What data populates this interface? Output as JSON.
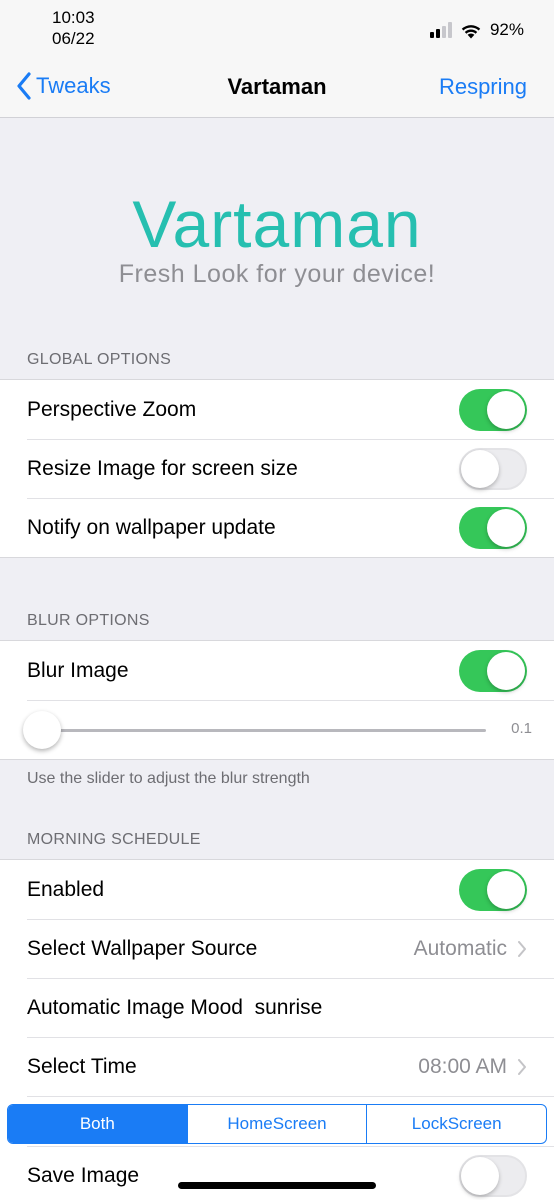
{
  "status_bar": {
    "time": "10:03",
    "date": "06/22",
    "battery": "92%",
    "icons": [
      "signal-icon",
      "wifi-icon"
    ]
  },
  "nav": {
    "back_label": "Tweaks",
    "title": "Vartaman",
    "action_label": "Respring"
  },
  "header": {
    "title": "Vartaman",
    "subtitle": "Fresh Look for your device!"
  },
  "global_options": {
    "header": "GLOBAL OPTIONS",
    "rows": [
      {
        "label": "Perspective Zoom",
        "on": true
      },
      {
        "label": "Resize Image for screen size",
        "on": false
      },
      {
        "label": "Notify on wallpaper update",
        "on": true
      }
    ]
  },
  "blur_options": {
    "header": "BLUR OPTIONS",
    "blur_label": "Blur Image",
    "blur_on": true,
    "slider_value": "0.1",
    "slider_fraction": 0.0,
    "footer": "Use the slider to adjust the blur strength"
  },
  "morning_schedule": {
    "header": "MORNING SCHEDULE",
    "enabled_label": "Enabled",
    "enabled_on": true,
    "source_label": "Select Wallpaper Source",
    "source_value": "Automatic",
    "mood_label": "Automatic Image Mood  sunrise",
    "time_label": "Select Time",
    "time_value": "08:00 AM",
    "segments": [
      "Both",
      "HomeScreen",
      "LockScreen"
    ],
    "selected_segment": "Both",
    "save_label": "Save Image",
    "save_on": false
  },
  "colors": {
    "accent": "#1a7cf5",
    "toggle_on": "#35c759",
    "brand": "#26bfb0"
  }
}
